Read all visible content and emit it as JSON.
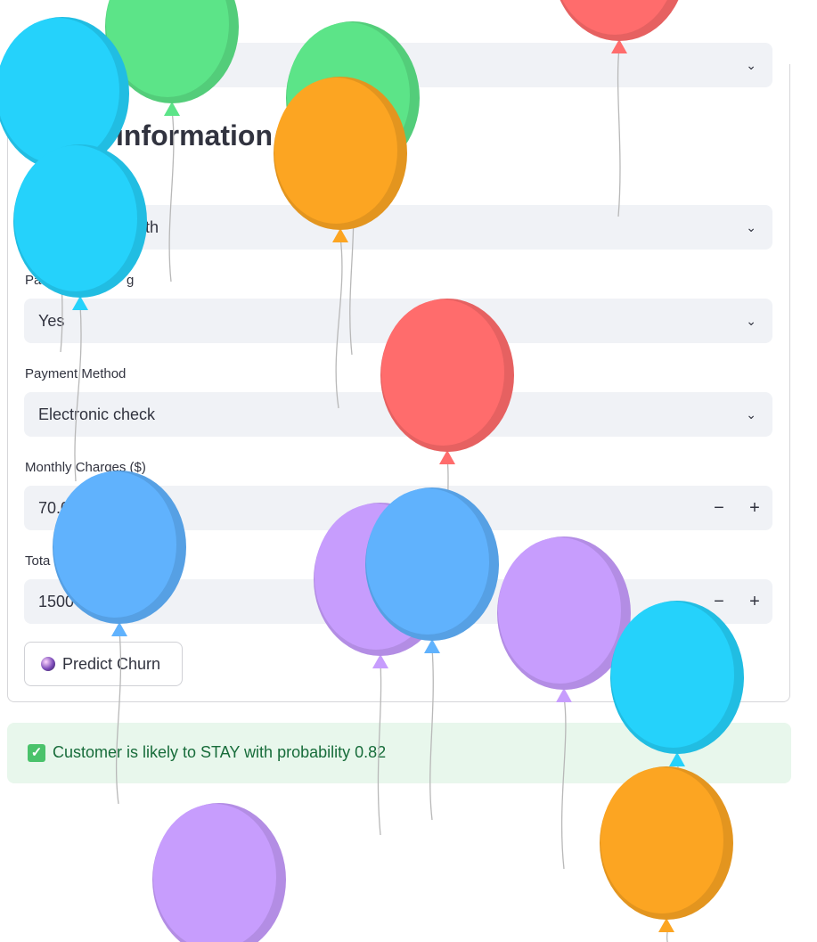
{
  "section": {
    "title": "information"
  },
  "fields": [
    {
      "id": "contract",
      "label": "",
      "value": "th"
    },
    {
      "id": "paperless",
      "label": "Pa",
      "label_tail": "g",
      "value": "Yes"
    },
    {
      "id": "payment",
      "label": "Payment Method",
      "value": "Electronic check"
    },
    {
      "id": "monthly",
      "label": "Monthly Charges ($)",
      "value": "70.0"
    },
    {
      "id": "total",
      "label": "Tota",
      "value": "1500"
    }
  ],
  "stepper": {
    "minus": "−",
    "plus": "+"
  },
  "predict_button": {
    "label": "Predict Churn",
    "icon": "crystal-ball-icon"
  },
  "result": {
    "message": "Customer is likely to STAY with probability 0.82",
    "icon": "check-icon",
    "color": "#176c3a",
    "background": "#e8f7ec"
  },
  "balloon_colors": {
    "red": "#ff6c6c",
    "green": "#5ce488",
    "cyan": "#25d2fb",
    "orange": "#fca522",
    "blue": "#60b2fd",
    "purple": "#c79dfd"
  }
}
